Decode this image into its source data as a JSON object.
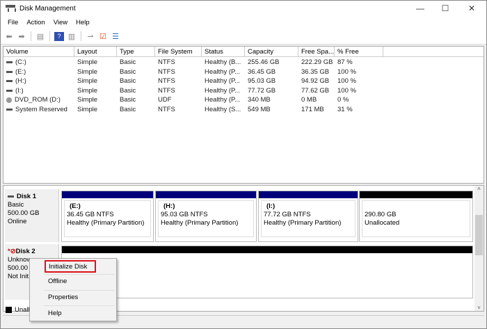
{
  "window": {
    "title": "Disk Management",
    "minimize": "—",
    "maximize": "☐",
    "close": "✕"
  },
  "menu": [
    "File",
    "Action",
    "View",
    "Help"
  ],
  "toolbar": [
    "back-icon",
    "forward-icon",
    "console-tree-icon",
    "help-icon",
    "show-pane-icon",
    "connect-icon",
    "check-icon",
    "properties-icon"
  ],
  "columns": [
    "Volume",
    "Layout",
    "Type",
    "File System",
    "Status",
    "Capacity",
    "Free Spa...",
    "% Free"
  ],
  "volumes": [
    {
      "name": "(C:)",
      "layout": "Simple",
      "type": "Basic",
      "fs": "NTFS",
      "status": "Healthy (B...",
      "capacity": "255.46 GB",
      "free": "222.29 GB",
      "pct": "87 %"
    },
    {
      "name": "(E:)",
      "layout": "Simple",
      "type": "Basic",
      "fs": "NTFS",
      "status": "Healthy (P...",
      "capacity": "36.45 GB",
      "free": "36.35 GB",
      "pct": "100 %"
    },
    {
      "name": "(H:)",
      "layout": "Simple",
      "type": "Basic",
      "fs": "NTFS",
      "status": "Healthy (P...",
      "capacity": "95.03 GB",
      "free": "94.92 GB",
      "pct": "100 %"
    },
    {
      "name": "(I:)",
      "layout": "Simple",
      "type": "Basic",
      "fs": "NTFS",
      "status": "Healthy (P...",
      "capacity": "77.72 GB",
      "free": "77.62 GB",
      "pct": "100 %"
    },
    {
      "name": "DVD_ROM (D:)",
      "layout": "Simple",
      "type": "Basic",
      "fs": "UDF",
      "status": "Healthy (P...",
      "capacity": "340 MB",
      "free": "0 MB",
      "pct": "0 %"
    },
    {
      "name": "System Reserved",
      "layout": "Simple",
      "type": "Basic",
      "fs": "NTFS",
      "status": "Healthy (S...",
      "capacity": "549 MB",
      "free": "171 MB",
      "pct": "31 %"
    }
  ],
  "disk1": {
    "name": "Disk 1",
    "type": "Basic",
    "size": "500.00 GB",
    "state": "Online",
    "partitions": [
      {
        "label": "(E:)",
        "size": "36.45 GB NTFS",
        "status": "Healthy (Primary Partition)"
      },
      {
        "label": "(H:)",
        "size": "95.03 GB NTFS",
        "status": "Healthy (Primary Partition)"
      },
      {
        "label": "(I:)",
        "size": "77.72 GB NTFS",
        "status": "Healthy (Primary Partition)"
      },
      {
        "label": "",
        "size": "290.80 GB",
        "status": "Unallocated"
      }
    ]
  },
  "disk2": {
    "name": "Disk 2",
    "type": "Unknow",
    "size": "500.00 (",
    "state": "Not Init"
  },
  "legend": {
    "unallocated": "Unall"
  },
  "context_menu": [
    "Initialize Disk",
    "Offline",
    "Properties",
    "Help"
  ],
  "colors": {
    "primary": "#00007b",
    "unallocated": "#000000",
    "highlight": "#e0101a"
  }
}
